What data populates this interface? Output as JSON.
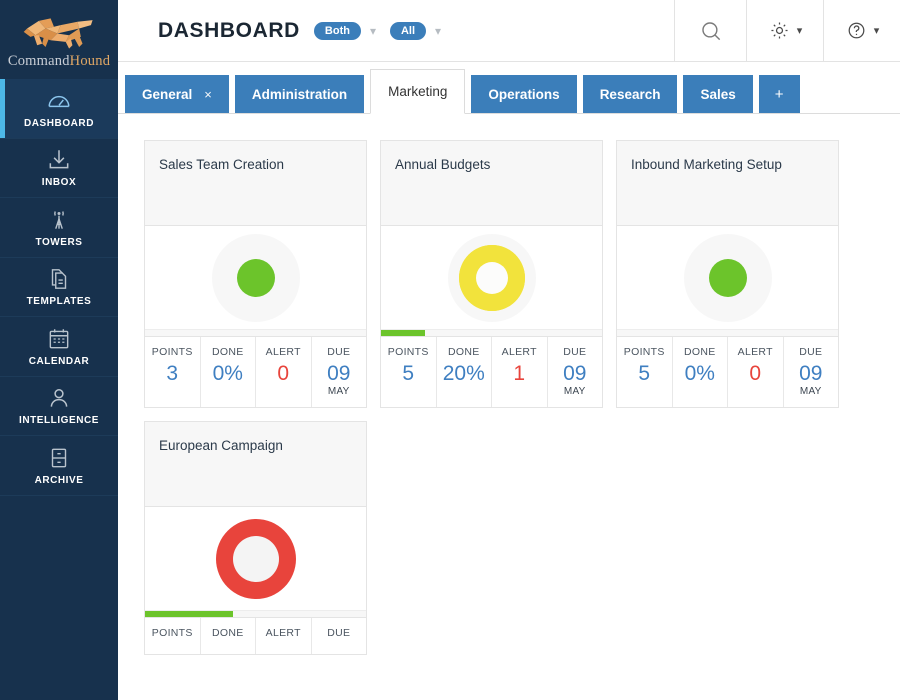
{
  "brand": {
    "name_part1": "Command",
    "name_part2": "Hound",
    "logo_icon": "dog-logo-icon",
    "accent_color": "#4db8e8",
    "sidebar_bg": "#17314d"
  },
  "sidebar": {
    "items": [
      {
        "label": "DASHBOARD",
        "icon": "gauge-icon",
        "active": true
      },
      {
        "label": "INBOX",
        "icon": "inbox-download-icon",
        "active": false
      },
      {
        "label": "TOWERS",
        "icon": "tower-antenna-icon",
        "active": false
      },
      {
        "label": "TEMPLATES",
        "icon": "documents-icon",
        "active": false
      },
      {
        "label": "CALENDAR",
        "icon": "calendar-icon",
        "active": false
      },
      {
        "label": "INTELLIGENCE",
        "icon": "person-icon",
        "active": false
      },
      {
        "label": "ARCHIVE",
        "icon": "file-cabinet-icon",
        "active": false
      }
    ]
  },
  "header": {
    "title": "DASHBOARD",
    "filter_scope": "Both",
    "filter_range": "All",
    "search_icon": "search-icon",
    "settings_icon": "gear-icon",
    "help_icon": "question-circle-icon",
    "pill_color": "#3b7eba"
  },
  "tabs": {
    "items": [
      {
        "label": "General",
        "active": false,
        "closable": true
      },
      {
        "label": "Administration",
        "active": false,
        "closable": false
      },
      {
        "label": "Marketing",
        "active": true,
        "closable": false
      },
      {
        "label": "Operations",
        "active": false,
        "closable": false
      },
      {
        "label": "Research",
        "active": false,
        "closable": false
      },
      {
        "label": "Sales",
        "active": false,
        "closable": false
      }
    ],
    "add_label": "+",
    "close_glyph": "×",
    "tab_color": "#3b7eba"
  },
  "stat_labels": {
    "points": "POINTS",
    "done": "DONE",
    "alert": "ALERT",
    "due": "DUE"
  },
  "colors": {
    "green": "#6cc42b",
    "yellow": "#f2e33c",
    "red": "#e8443c",
    "value_blue": "#3f7fc1"
  },
  "cards": [
    {
      "title": "Sales Team Creation",
      "status": "green",
      "status_shape": "dot",
      "progress_percent": 0,
      "points": "3",
      "done": "0%",
      "alert": "0",
      "due_day": "09",
      "due_month": "MAY"
    },
    {
      "title": "Annual Budgets",
      "status": "yellow",
      "status_shape": "ring",
      "progress_percent": 20,
      "points": "5",
      "done": "20%",
      "alert": "1",
      "due_day": "09",
      "due_month": "MAY"
    },
    {
      "title": "Inbound Marketing Setup",
      "status": "green",
      "status_shape": "dot",
      "progress_percent": 0,
      "points": "5",
      "done": "0%",
      "alert": "0",
      "due_day": "09",
      "due_month": "MAY"
    },
    {
      "title": "European Campaign",
      "status": "red",
      "status_shape": "ring",
      "progress_percent": 40,
      "points": "",
      "done": "",
      "alert": "",
      "due_day": "",
      "due_month": ""
    }
  ]
}
